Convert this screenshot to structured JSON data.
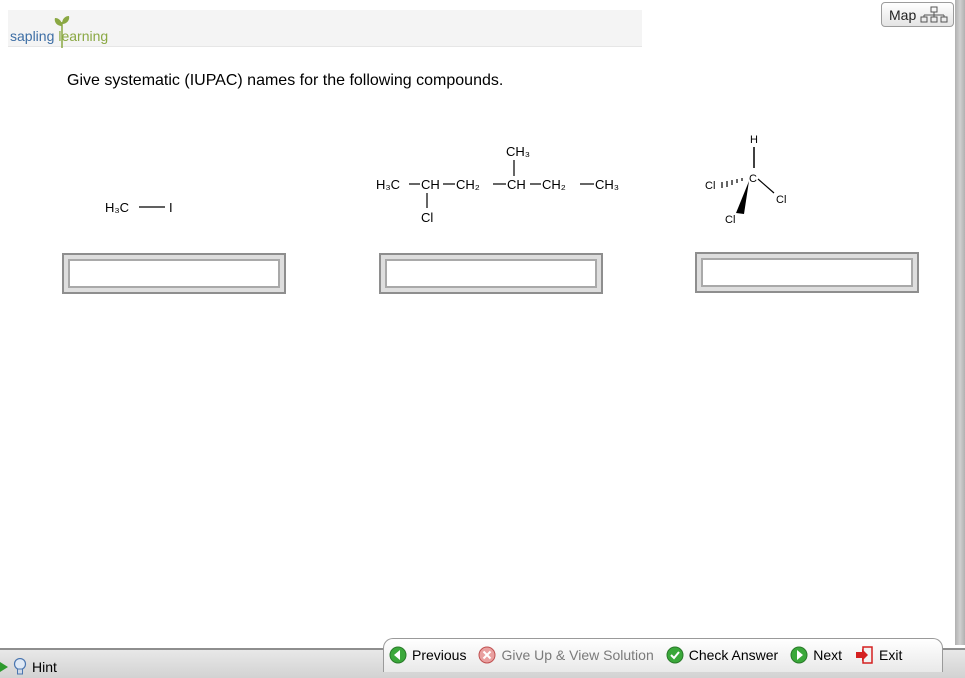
{
  "header": {
    "logo_sapling": "sapling",
    "logo_learning": "learning",
    "map_label": "Map"
  },
  "question": {
    "instruction": "Give systematic (IUPAC) names for the following compounds."
  },
  "compounds": {
    "c1": {
      "formula_h3c": "H₃C",
      "formula_i": "I"
    },
    "c2": {
      "ch3_top": "CH₃",
      "main_chain": [
        "H₃C",
        "CH",
        "CH₂",
        "CH",
        "CH₂",
        "CH₃"
      ],
      "cl": "Cl"
    },
    "c3": {
      "h": "H",
      "c": "C",
      "cl_left": "Cl",
      "cl_right": "Cl",
      "cl_bottom": "Cl"
    }
  },
  "answers": [
    {
      "value": "",
      "placeholder": ""
    },
    {
      "value": "",
      "placeholder": ""
    },
    {
      "value": "",
      "placeholder": ""
    }
  ],
  "footer": {
    "hint_label": "Hint",
    "previous_label": "Previous",
    "giveup_label": "Give Up & View Solution",
    "check_label": "Check Answer",
    "next_label": "Next",
    "exit_label": "Exit"
  },
  "colors": {
    "accent_green": "#3aa83a",
    "giveup_red": "#d9534f",
    "exit_red": "#d42020"
  }
}
